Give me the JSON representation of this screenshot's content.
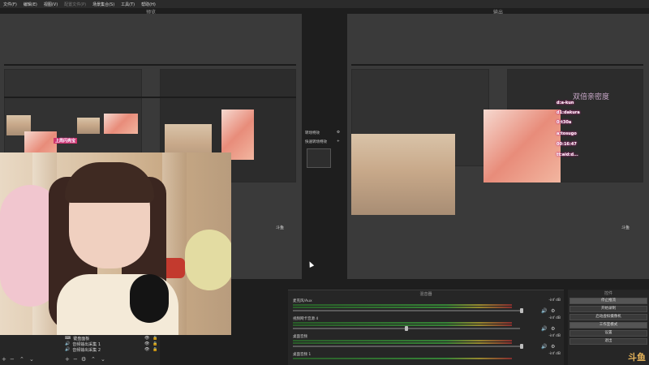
{
  "menu": {
    "items": [
      "文件(F)",
      "编辑(E)",
      "视图(V)",
      "配置文件(P)",
      "场景集合(S)",
      "工具(T)",
      "帮助(H)"
    ]
  },
  "panels": {
    "preview_title": "预览",
    "program_title": "输出"
  },
  "transition": {
    "items": [
      "转场特效",
      "快速转场特效"
    ]
  },
  "sources": {
    "items": [
      "键盘面板",
      "音频输出采集 1",
      "音频输出采集 2"
    ]
  },
  "mixer": {
    "title": "混音器",
    "channels": [
      {
        "name": "麦克风/Aux",
        "db": "-inf dB"
      },
      {
        "name": "视频网卡音源 4",
        "db": "-inf dB"
      },
      {
        "name": "桌面音频",
        "db": "-inf dB"
      },
      {
        "name": "桌面音频 1",
        "db": "-inf dB"
      }
    ]
  },
  "controls": {
    "title": "控件",
    "buttons": [
      "停止推流",
      "开始录制",
      "启动虚拟摄像机",
      "工作室模式",
      "设置",
      "退出"
    ]
  },
  "overlay": {
    "double_anchor": "双倍亲密度",
    "badge_text": "上周闪亮宝",
    "lines": [
      "d:a-kun",
      "d1:dakura",
      "0:t30a",
      "a:tosugo",
      "00:16:47",
      "tt:aid:d..."
    ]
  },
  "watermark": "斗鱼",
  "watermark_small": "斗鱼",
  "colors": {
    "panel_bg": "#1e1e1e",
    "canvas_bg": "#3a3a3a",
    "watermark": "#e6b45a"
  }
}
